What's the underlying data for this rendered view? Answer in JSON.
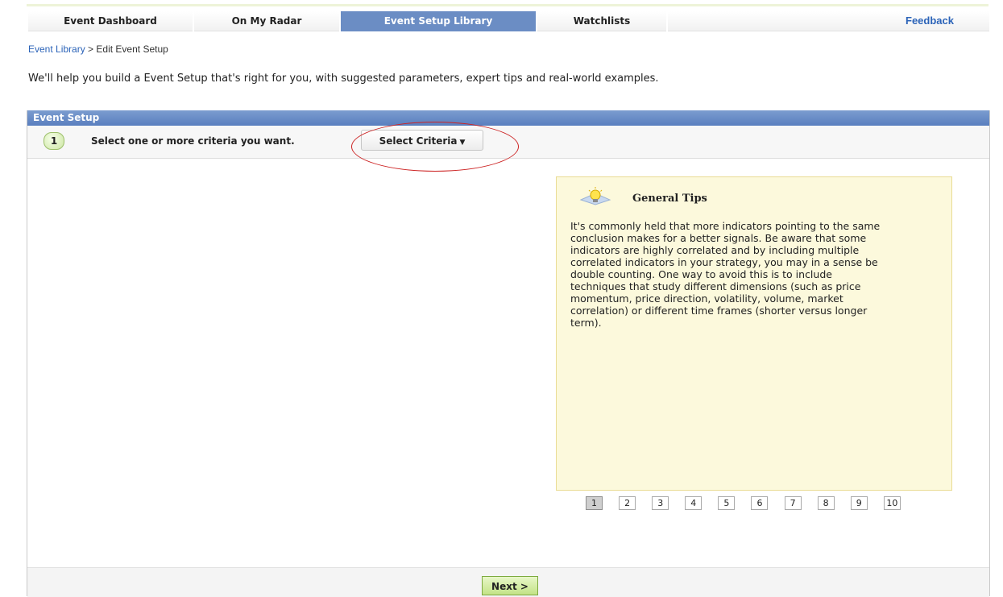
{
  "tabs": [
    {
      "label": "Event Dashboard",
      "active": false
    },
    {
      "label": "On My Radar",
      "active": false
    },
    {
      "label": "Event Setup Library",
      "active": true
    },
    {
      "label": "Watchlists",
      "active": false
    }
  ],
  "feedback_label": "Feedback",
  "breadcrumb": {
    "link": "Event Library",
    "separator": ">",
    "current": "Edit Event Setup"
  },
  "intro_text": "We'll help you build a Event Setup that's right for you, with suggested parameters, expert tips and real-world examples.",
  "panel": {
    "title": "Event Setup",
    "step": {
      "number": "1",
      "text": "Select one or more criteria you want.",
      "dropdown_label": "Select Criteria"
    }
  },
  "tips": {
    "icon": "lightbulb-icon",
    "title": "General Tips",
    "body": "It's commonly held that more indicators pointing to the same conclusion makes for a better signals. Be aware that some indicators are highly correlated and by including multiple correlated indicators in your strategy, you may in a sense be double counting. One way to avoid this is to include techniques that study different dimensions (such as price momentum, price direction, volatility, volume, market correlation) or different time frames (shorter versus longer term).",
    "pages": [
      "1",
      "2",
      "3",
      "4",
      "5",
      "6",
      "7",
      "8",
      "9",
      "10"
    ],
    "current_page": "1"
  },
  "next_label": "Next >",
  "colors": {
    "active_tab": "#6b8dc4",
    "panel_header": "#5a7fbf",
    "tips_bg": "#fcf9dc",
    "highlight": "#cc2222",
    "next_button": "#c3e386"
  }
}
